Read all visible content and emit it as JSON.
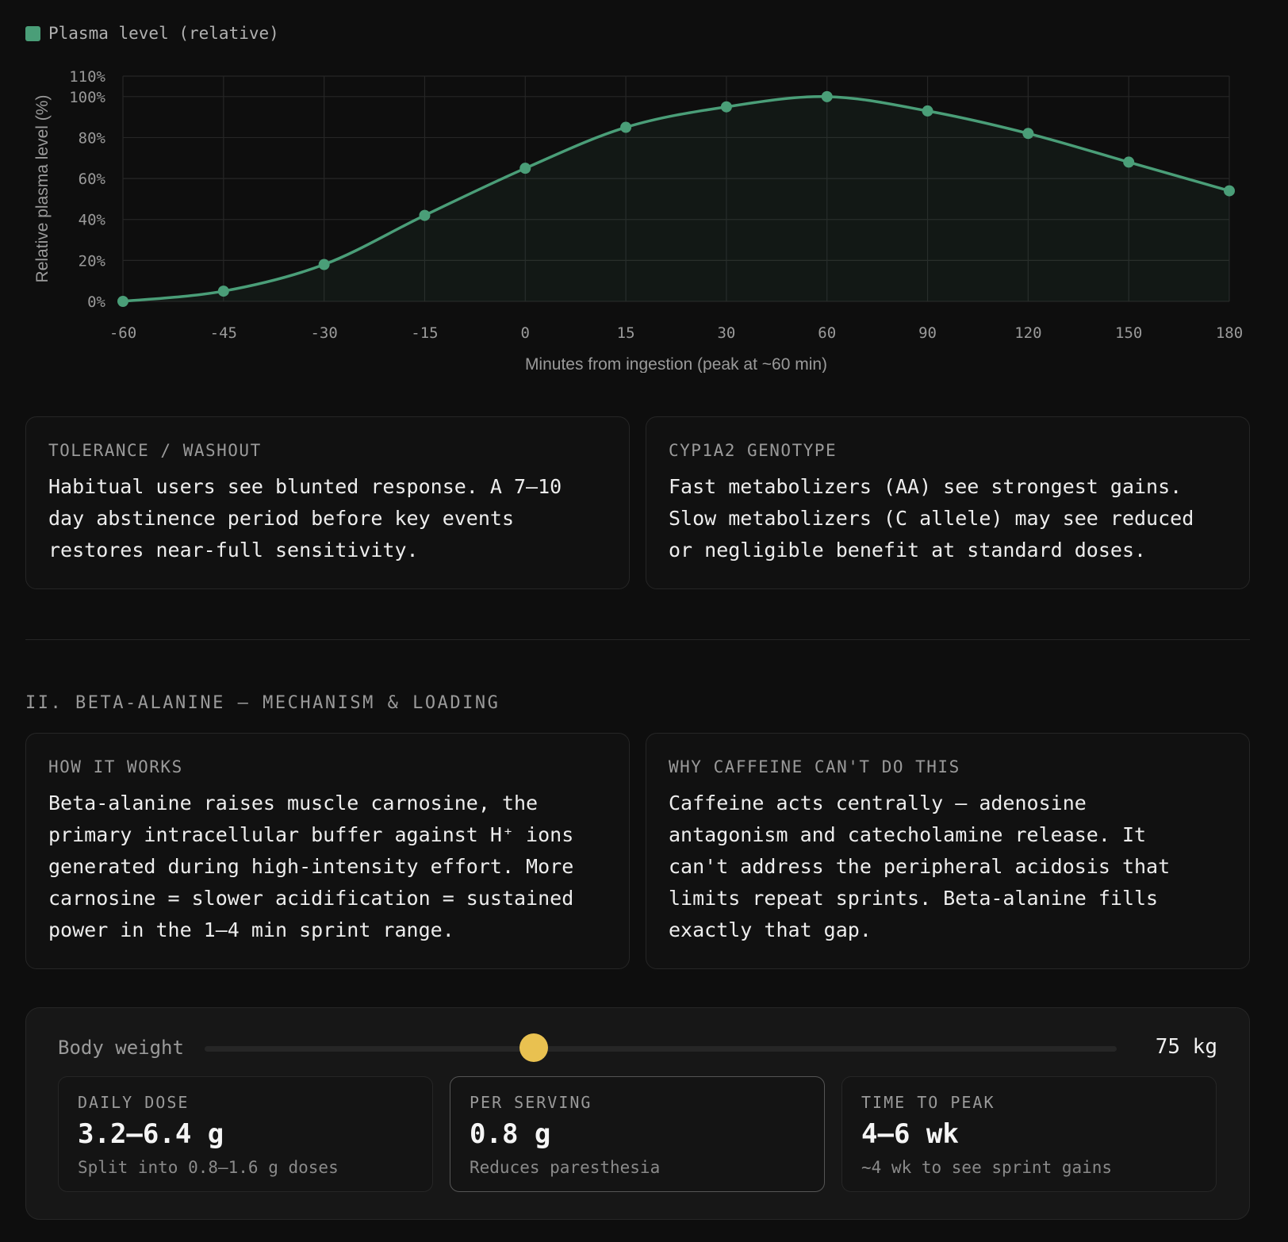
{
  "chart_data": {
    "type": "line",
    "legend": "Plasma level (relative)",
    "xlabel": "Minutes from ingestion (peak at ~60 min)",
    "ylabel": "Relative plasma level (%)",
    "x_categories": [
      "-60",
      "-45",
      "-30",
      "-15",
      "0",
      "15",
      "30",
      "60",
      "90",
      "120",
      "150",
      "180"
    ],
    "y_ticks": [
      "0%",
      "20%",
      "40%",
      "60%",
      "80%",
      "100%",
      "110%"
    ],
    "ylim": [
      0,
      110
    ],
    "series": [
      {
        "name": "Plasma level (relative)",
        "values": [
          0,
          5,
          18,
          42,
          65,
          85,
          95,
          100,
          93,
          82,
          68,
          54
        ]
      }
    ],
    "color": "#4a9e78",
    "grid": true
  },
  "cards": {
    "tolerance": {
      "label": "TOLERANCE / WASHOUT",
      "lines": [
        "Habitual users see blunted response. A 7–10",
        "day abstinence period before key events",
        "restores near-full sensitivity."
      ]
    },
    "genotype": {
      "label": "CYP1A2 GENOTYPE",
      "lines": [
        "Fast metabolizers (AA) see strongest gains.",
        "Slow metabolizers (C allele) may see reduced",
        "or negligible benefit at standard doses."
      ]
    },
    "how": {
      "label": "HOW IT WORKS",
      "lines": [
        "Beta-alanine raises muscle carnosine, the",
        "primary intracellular buffer against H⁺ ions",
        "generated during high-intensity effort. More",
        "carnosine = slower acidification = sustained",
        "power in the 1–4 min sprint range."
      ]
    },
    "why": {
      "label": "WHY CAFFEINE CAN'T DO THIS",
      "lines": [
        "Caffeine acts centrally — adenosine",
        "antagonism and catecholamine release. It",
        "can't address the peripheral acidosis that",
        "limits repeat sprints. Beta-alanine fills",
        "exactly that gap."
      ]
    }
  },
  "section_title": "II. BETA-ALANINE — MECHANISM & LOADING",
  "calculator": {
    "weight_label": "Body weight",
    "weight_value": "75 kg",
    "slider_fraction": 0.361,
    "accent": "#e9c150",
    "stats": [
      {
        "label": "DAILY DOSE",
        "value": "3.2–6.4 g",
        "note": "Split into 0.8–1.6 g doses"
      },
      {
        "label": "PER SERVING",
        "value": "0.8 g",
        "note": "Reduces paresthesia"
      },
      {
        "label": "TIME TO PEAK",
        "value": "4–6 wk",
        "note": "~4 wk to see sprint gains"
      }
    ]
  }
}
